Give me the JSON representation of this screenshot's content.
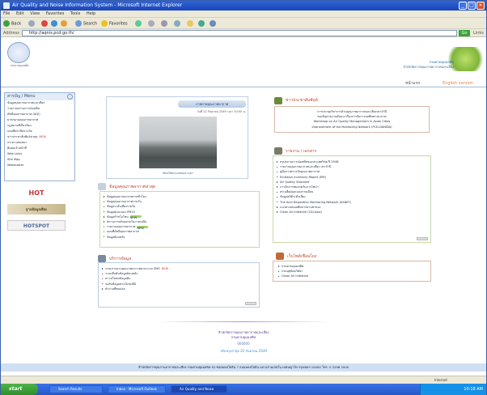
{
  "window": {
    "title": "Air Quality and Noise Information System - Microsoft Internet Explorer",
    "minimize": "_",
    "maximize": "□",
    "close": "×"
  },
  "menu": [
    "File",
    "Edit",
    "View",
    "Favorites",
    "Tools",
    "Help"
  ],
  "toolbar": {
    "back": "Back",
    "search": "Search",
    "favorites": "Favorites"
  },
  "address": {
    "label": "Address",
    "value": "http://aqnis.pcd.go.th/",
    "go": "Go",
    "links": "Links"
  },
  "header": {
    "logo_caption": "กรมควบคุมมลพิษ",
    "brand_line1": "กรมควบคุมมลพิษ",
    "brand_line2": "สำนักจัดการคุณภาพอากาศและเสียง",
    "nav_home": "หน้าแรก",
    "nav_english": "English version"
  },
  "sidebar": {
    "title": "สารบัญ / Menu",
    "items": [
      {
        "label": "ข้อมูลคุณภาพอากาศและเสียง",
        "new": ""
      },
      {
        "label": "รายงานสถานการณ์มลพิษ",
        "new": ""
      },
      {
        "label": "ดัชนีคุณภาพอากาศ (AQI)",
        "new": ""
      },
      {
        "label": "มาตรฐานคุณภาพอากาศ",
        "new": ""
      },
      {
        "label": "กฎหมายที่เกี่ยวข้อง",
        "new": ""
      },
      {
        "label": "แผนที่สถานีตรวจวัด",
        "new": ""
      },
      {
        "label": "ข่าวประชาสัมพันธ์ล่าสุด",
        "new": "NEW"
      },
      {
        "label": "กระดานสนทนา",
        "new": ""
      },
      {
        "label": "ติดต่อเจ้าหน้าที่",
        "new": ""
      },
      {
        "label": "Web Links",
        "new": ""
      },
      {
        "label": "Site Map",
        "new": ""
      },
      {
        "label": "Webmaster",
        "new": ""
      }
    ],
    "banner1": "HOT",
    "banner2": "ฐานข้อมูลเสียง",
    "banner3": "HOTSPOT"
  },
  "photo_box": {
    "title": "ภาพถ่ายคุณภาพอากาศ",
    "date": "วันที่ 22 กันยายน 2549 เวลา 10:00 น.",
    "caption": "ทัศนวิสัยกรุงเทพมหานคร"
  },
  "news_panel": {
    "title": "ข่าวประชาสัมพันธ์",
    "text_lines": [
      "การประชุมวิชาการด้านคุณภาพอากาศและเสียงประจำปี",
      "ขอเชิญร่วมงานสัมมนาเรื่องการจัดการมลพิษทางอากาศ",
      "Workshop on Air Quality Management in Asian Cities",
      "Improvement of the Monitoring Network (PCD-DANIDA)"
    ]
  },
  "reports_panel": {
    "title": "รายงาน / เอกสาร",
    "items": [
      {
        "label": "สรุปสถานการณ์มลพิษของประเทศไทย ปี 2548",
        "new": ""
      },
      {
        "label": "รายงานคุณภาพอากาศและเสียง ประจำปี",
        "new": ""
      },
      {
        "label": "คู่มือการตรวจวัดคุณภาพอากาศ",
        "new": ""
      },
      {
        "label": "Emission Inventory Report (EIR)",
        "new": ""
      },
      {
        "label": "Air Quality Standard",
        "new": ""
      },
      {
        "label": "การจัดการหมอกควันจากไฟป่า",
        "new": ""
      },
      {
        "label": "ค่าเฉลี่ยฝุ่นละอองรายเดือน",
        "new": ""
      },
      {
        "label": "ข้อมูลสถิติระดับเสียง",
        "new": ""
      },
      {
        "label": "The Acid Deposition Monitoring Network (EANET)",
        "new": ""
      },
      {
        "label": "แนวทางลดมลพิษจากยานพาหนะ",
        "new": ""
      },
      {
        "label": "Clean Air Initiative (CAI-Asia)",
        "new": ""
      }
    ]
  },
  "data_panel": {
    "title": "ข้อมูลคุณภาพอากาศล่าสุด",
    "items": [
      {
        "label": "ข้อมูลคุณภาพอากาศรายชั่วโมง",
        "new": ""
      },
      {
        "label": "ข้อมูลคุณภาพอากาศรายวัน",
        "new": ""
      },
      {
        "label": "ข้อมูลระดับเสียงรายวัน",
        "new": ""
      },
      {
        "label": "ข้อมูลฝุ่นละออง PM10",
        "new": ""
      },
      {
        "label": "ข้อมูลก๊าซโอโซน",
        "new": "NEW"
      },
      {
        "label": "สถานการณ์หมอกควันภาคเหนือ",
        "new": ""
      },
      {
        "label": "รายงานคุณภาพอากาศ",
        "new": "NEW"
      },
      {
        "label": "แผนที่ดัชนีคุณภาพอากาศ",
        "new": ""
      },
      {
        "label": "ข้อมูลย้อนหลัง",
        "new": ""
      }
    ]
  },
  "services_panel": {
    "title": "บริการข้อมูล",
    "items": [
      {
        "label": "ระบบรายงานคุณภาพอากาศผ่านระบบ SMS",
        "new": "NEW"
      },
      {
        "label": "ระบบสืบค้นข้อมูลย้อนหลัง",
        "new": ""
      },
      {
        "label": "ดาวน์โหลดข้อมูลดิบ",
        "new": ""
      },
      {
        "label": "ขอรับข้อมูลทางไปรษณีย์",
        "new": ""
      },
      {
        "label": "คำถามที่พบบ่อย",
        "new": ""
      }
    ]
  },
  "links_panel": {
    "title": "เว็บไซต์เชื่อมโยง",
    "items": [
      {
        "label": "กรมควบคุมมลพิษ"
      },
      {
        "label": "กรมอุตุนิยมวิทยา"
      },
      {
        "label": "Clean Air Initiative"
      }
    ]
  },
  "center": {
    "line1": "สำนักจัดการคุณภาพอากาศและเสียง",
    "line2": "กรมควบคุมมลพิษ",
    "counter": "000000",
    "line3": "ปรับปรุงล่าสุด 22 กันยายน 2549"
  },
  "footer": {
    "text": "สำนักจัดการคุณภาพอากาศและเสียง กรมควบคุมมลพิษ 92 ซอยพหลโยธิน 7 ถนนพหลโยธิน แขวงสามเสนใน เขตพญาไท กรุงเทพฯ 10400 โทร. 0 2298 2000"
  },
  "status": {
    "zone": "Internet"
  },
  "taskbar": {
    "start": "start",
    "tasks": [
      "Search Results",
      "Inbox - Microsoft Outlook",
      "Air Quality and Noise"
    ],
    "clock": "10:18 AM"
  },
  "colors": {
    "accent": "#c0442c",
    "link": "#3a6aa5",
    "header_blue": "#2f63d6"
  }
}
